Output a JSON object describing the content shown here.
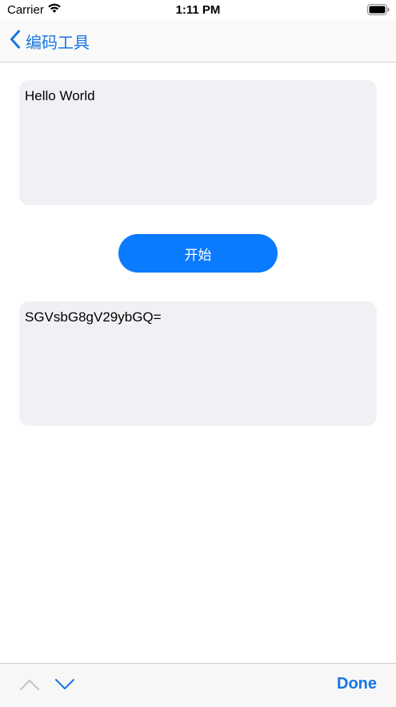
{
  "status_bar": {
    "carrier": "Carrier",
    "time": "1:11 PM"
  },
  "nav": {
    "back_title": "编码工具"
  },
  "input": {
    "value": "Hello World"
  },
  "start_button": {
    "label": "开始"
  },
  "output": {
    "value": "SGVsbG8gV29ybGQ="
  },
  "accessory": {
    "done_label": "Done"
  },
  "colors": {
    "accent": "#1677e5",
    "button": "#0a7aff",
    "field_bg": "#f1f1f5"
  }
}
